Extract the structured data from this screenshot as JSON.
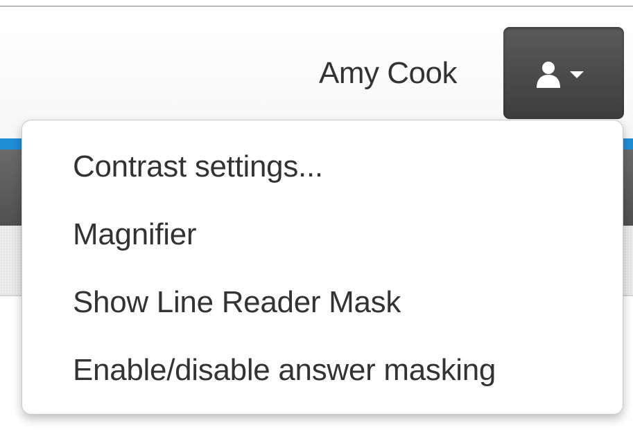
{
  "header": {
    "user_name": "Amy Cook",
    "user_button": {
      "icon": "user-icon",
      "caret_icon": "caret-down-icon"
    }
  },
  "colors": {
    "accent_bar": "#1f8dd6",
    "nav_bar": "#555555",
    "user_button": "#4a4a4a",
    "text": "#333333"
  },
  "dropdown": {
    "items": [
      {
        "label": "Contrast settings..."
      },
      {
        "label": "Magnifier"
      },
      {
        "label": "Show Line Reader Mask"
      },
      {
        "label": "Enable/disable answer masking"
      }
    ]
  }
}
